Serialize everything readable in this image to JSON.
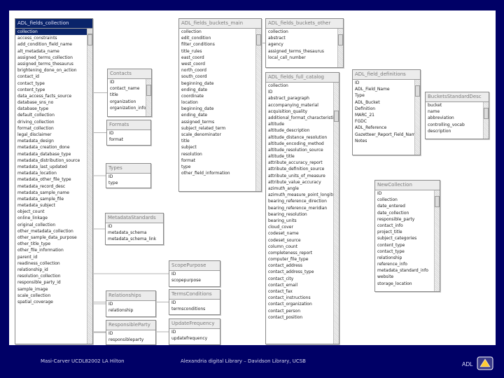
{
  "footer": {
    "left": "Masi-Carver UCDL82002 LA Hilton",
    "center": "Alexandria digital Library – Davidson Library, UCSB",
    "logo_text": "ADL"
  },
  "tables": [
    {
      "id": "fields-collection",
      "title": "ADL_fields_collection",
      "selected": true,
      "fields": [
        "collection",
        "access_constraints",
        "add_condition_field_name",
        "alt_metadata_name",
        "assigned_terms_collection",
        "assigned_terms_thesaurus",
        "brightening_done_on_action",
        "contact_id",
        "contact_type",
        "content_type",
        "data_access_facts_source",
        "database_sns_no",
        "database_type",
        "default_collection",
        "driving_collection",
        "format_collection",
        "legal_disclaimer",
        "metadata_design",
        "metadata_creation_done",
        "metadata_database_type",
        "metadata_distribution_source",
        "metadata_last_updated",
        "metadata_location",
        "metadata_other_file_type",
        "metadata_record_desc",
        "metadata_sample_name",
        "metadata_sample_file",
        "metadata_subject",
        "object_count",
        "online_linkage",
        "original_collection",
        "other_metadata_collection",
        "other_sample_data_purpose",
        "other_title_type",
        "other_file_information",
        "parent_id",
        "readiness_collection",
        "relationship_id",
        "resolution_collection",
        "responsible_party_id",
        "sample_image",
        "scale_collection",
        "spatial_coverage"
      ]
    },
    {
      "id": "contacts",
      "title": "Contacts",
      "fields": [
        "ID",
        "contact_name",
        "title",
        "organization",
        "organization_info"
      ]
    },
    {
      "id": "formats",
      "title": "Formats",
      "fields": [
        "ID",
        "format"
      ]
    },
    {
      "id": "types",
      "title": "Types",
      "fields": [
        "ID",
        "type"
      ]
    },
    {
      "id": "metadata-standards",
      "title": "MetadataStandards",
      "fields": [
        "ID",
        "metadata_schema",
        "metadata_schema_link"
      ]
    },
    {
      "id": "relationships",
      "title": "Relationships",
      "fields": [
        "ID",
        "relationship"
      ]
    },
    {
      "id": "responsible-party",
      "title": "ResponsibleParty",
      "fields": [
        "ID",
        "responsibleparty"
      ]
    },
    {
      "id": "fields-buckets-main",
      "title": "ADL_fields_buckets_main",
      "fields": [
        "collection",
        "edit_condition",
        "filter_conditions",
        "title_rules",
        "east_coord",
        "west_coord",
        "north_coord",
        "south_coord",
        "beginning_date",
        "ending_date",
        "coordinate",
        "location",
        "beginning_date",
        "ending_date",
        "assigned_terms",
        "subject_related_term",
        "scale_denominator",
        "title",
        "subject",
        "resolution",
        "format",
        "type",
        "other_field_information"
      ]
    },
    {
      "id": "scope-purpose",
      "title": "ScopePurpose",
      "fields": [
        "ID",
        "scopepurpose"
      ]
    },
    {
      "id": "terms-conditions",
      "title": "TermsConditions",
      "fields": [
        "ID",
        "termsconditions"
      ]
    },
    {
      "id": "update-frequency",
      "title": "UpdateFrequency",
      "fields": [
        "ID",
        "updatefrequency"
      ]
    },
    {
      "id": "fields-buckets-other",
      "title": "ADL_fields_buckets_other",
      "fields": [
        "collection",
        "abstract",
        "agency",
        "assigned_terms_thesaurus",
        "local_call_number"
      ]
    },
    {
      "id": "fields-full-catalog",
      "title": "ADL_fields_full_catalog",
      "fields": [
        "collection",
        "ID",
        "abstract_paragraph",
        "accompanying_material",
        "acquisition_quality",
        "additional_format_characteristics",
        "altitude",
        "altitude_description",
        "altitude_distance_resolution",
        "altitude_encoding_method",
        "altitude_resolution_source",
        "altitude_title",
        "attribute_accuracy_report",
        "attribute_definition_source",
        "attribute_units_of_measure",
        "attribute_value_accuracy",
        "azimuth_angle",
        "azimuth_measure_point_longitude",
        "bearing_reference_direction",
        "bearing_reference_meridian",
        "bearing_resolution",
        "bearing_units",
        "cloud_cover",
        "codeset_name",
        "codeset_source",
        "column_count",
        "completeness_report",
        "computer_file_type",
        "contact_address",
        "contact_address_type",
        "contact_city",
        "contact_email",
        "contact_fax",
        "contact_instructions",
        "contact_organization",
        "contact_person",
        "contact_position"
      ]
    },
    {
      "id": "field-definitions",
      "title": "ADL_field_definitions",
      "fields": [
        "ID",
        "ADL_Field_Name",
        "Type",
        "ADL_Bucket",
        "Definition",
        "MARC_21",
        "FGDC",
        "ADL_Reference",
        "Gazetteer_Report_Field_Name",
        "Notes"
      ]
    },
    {
      "id": "buckets-standard-desc",
      "title": "BucketsStandardDesc",
      "fields": [
        "bucket",
        "name",
        "abbreviation",
        "controlling_vocab",
        "description"
      ]
    },
    {
      "id": "new-collection",
      "title": "NewCollection",
      "fields": [
        "ID",
        "collection",
        "date_entered",
        "date_collection",
        "responsible_party",
        "contact_info",
        "project_title",
        "subject_categories",
        "content_type",
        "contact_type",
        "relationship",
        "reference_info",
        "metadata_standard_info",
        "website",
        "storage_location"
      ]
    }
  ],
  "relations": [
    [
      "fields-collection",
      "contacts"
    ],
    [
      "fields-collection",
      "formats"
    ],
    [
      "fields-collection",
      "types"
    ],
    [
      "fields-collection",
      "metadata-standards"
    ],
    [
      "fields-collection",
      "relationships"
    ],
    [
      "fields-collection",
      "responsible-party"
    ],
    [
      "fields-collection",
      "scope-purpose"
    ],
    [
      "fields-collection",
      "terms-conditions"
    ],
    [
      "fields-collection",
      "update-frequency"
    ],
    [
      "fields-buckets-main",
      "fields-buckets-other"
    ]
  ]
}
